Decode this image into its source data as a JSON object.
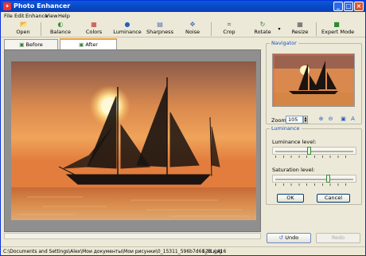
{
  "window": {
    "title": "Photo Enhancer",
    "app_icon": "photo-enhancer-icon",
    "controls": [
      "_",
      "□",
      "×"
    ]
  },
  "menu": [
    "File",
    "Edit",
    "Enhance",
    "View",
    "Help"
  ],
  "toolbar": [
    {
      "label": "Open",
      "icon": "open-folder-icon",
      "glyph": "📂"
    },
    {
      "label": "Balance",
      "icon": "balance-icon",
      "glyph": "◐"
    },
    {
      "label": "Colors",
      "icon": "colors-icon",
      "glyph": "▦"
    },
    {
      "label": "Luminance",
      "icon": "luminance-icon",
      "glyph": "●"
    },
    {
      "label": "Sharpness",
      "icon": "sharpness-icon",
      "glyph": "▤"
    },
    {
      "label": "Noise",
      "icon": "noise-icon",
      "glyph": "✥"
    },
    {
      "label": "Crop",
      "icon": "crop-icon",
      "glyph": "⌗"
    },
    {
      "label": "Rotate",
      "icon": "rotate-icon",
      "glyph": "↻"
    },
    {
      "label": "Resize",
      "icon": "resize-icon",
      "glyph": "▦"
    },
    {
      "label": "Expert Mode",
      "icon": "expert-mode-icon",
      "glyph": "■"
    }
  ],
  "tabs": [
    {
      "label": "Before",
      "active": false
    },
    {
      "label": "After",
      "active": true
    }
  ],
  "navigator": {
    "title": "Navigator",
    "zoom_label": "Zoom",
    "zoom_value": "105"
  },
  "luminance": {
    "title": "Luminance",
    "level_label": "Luminance level:",
    "level_value": 0.43,
    "saturation_label": "Saturation level:",
    "saturation_value": 0.67,
    "ok": "OK",
    "cancel": "Cancel"
  },
  "undo": "Undo",
  "redo": "Redo",
  "status": {
    "path": "C:\\Documents and Settings\\Alex\\Мои документы\\Мои рисунки\\0_15311_596b7d61_XL.jpg",
    "dimensions": "623 x 416"
  },
  "colors": {
    "titlebar": "#0a5ad8",
    "accent_tab": "#f3a13a",
    "group_title": "#1c4fb8"
  }
}
